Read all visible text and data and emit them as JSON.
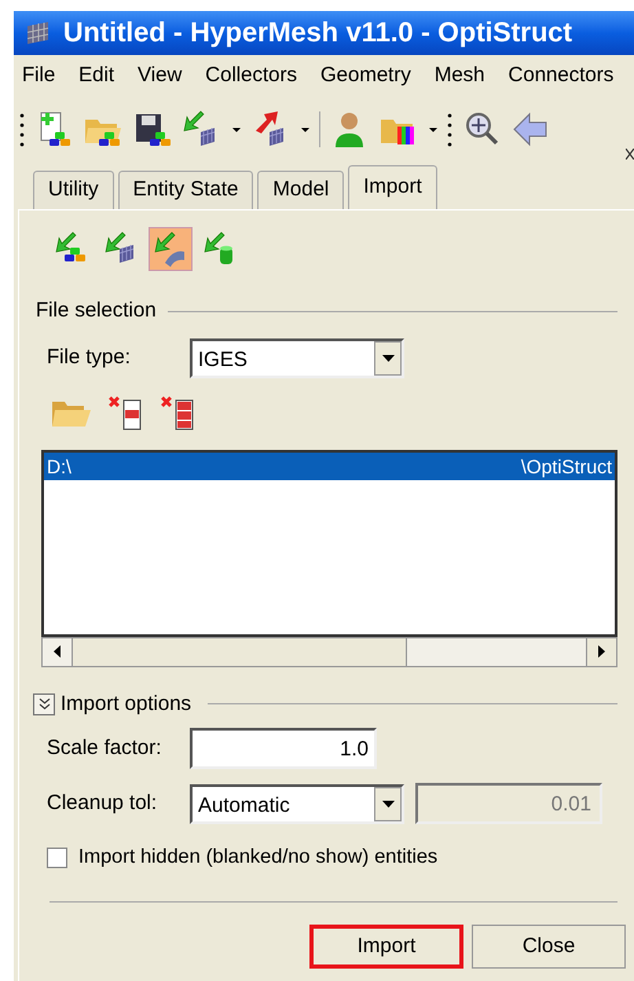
{
  "window": {
    "title": "Untitled - HyperMesh v11.0 - OptiStruct"
  },
  "menu": [
    "File",
    "Edit",
    "View",
    "Collectors",
    "Geometry",
    "Mesh",
    "Connectors"
  ],
  "tabs": [
    {
      "label": "Utility",
      "selected": false
    },
    {
      "label": "Entity State",
      "selected": false
    },
    {
      "label": "Model",
      "selected": false
    },
    {
      "label": "Import",
      "selected": true
    }
  ],
  "import_types": [
    {
      "kind": "model",
      "selected": false
    },
    {
      "kind": "fe",
      "selected": false
    },
    {
      "kind": "geometry",
      "selected": true
    },
    {
      "kind": "solver",
      "selected": false
    }
  ],
  "file_selection": {
    "title": "File selection",
    "file_type_label": "File type:",
    "file_type": "IGES",
    "files": [
      {
        "path_start": "D:\\",
        "path_end": "\\OptiStruct",
        "selected": true
      }
    ]
  },
  "import_options": {
    "title": "Import options",
    "expanded": true,
    "scale_label": "Scale factor:",
    "scale": "1.0",
    "cleanup_label": "Cleanup tol:",
    "cleanup": "Automatic",
    "cleanup_value": "0.01",
    "cleanup_value_disabled": true,
    "hidden_label": "Import hidden (blanked/no show) entities",
    "hidden_checked": false
  },
  "buttons": [
    {
      "label": "Import",
      "highlighted": true
    },
    {
      "label": "Close",
      "highlighted": false
    }
  ]
}
